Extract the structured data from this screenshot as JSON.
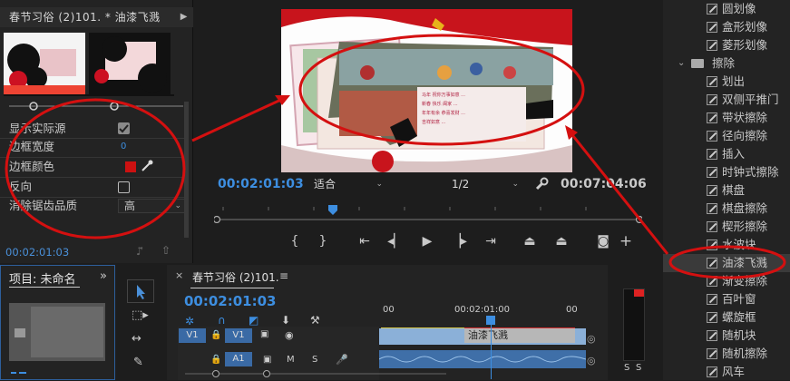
{
  "effect_controls": {
    "header": "春节习俗 (2)101. * 油漆飞溅",
    "props": [
      {
        "label": "显示实际源",
        "value": ""
      },
      {
        "label": "边框宽度",
        "value": "0"
      },
      {
        "label": "边框颜色",
        "value": ""
      },
      {
        "label": "反向",
        "value": ""
      },
      {
        "label": "消除锯齿品质",
        "value": "高"
      }
    ],
    "timecode": "00:02:01:03",
    "border_color": "#cc1111"
  },
  "program": {
    "current_time": "00:02:01:03",
    "fit": "适合",
    "resolution": "1/2",
    "duration": "00:07:04:06"
  },
  "effects_list": {
    "items": [
      "圆划像",
      "盒形划像",
      "菱形划像",
      "擦除",
      "划出",
      "双侧平推门",
      "带状擦除",
      "径向擦除",
      "插入",
      "时钟式擦除",
      "棋盘",
      "棋盘擦除",
      "楔形擦除",
      "水波块",
      "油漆飞溅",
      "渐变擦除",
      "百叶窗",
      "螺旋框",
      "随机块",
      "随机擦除",
      "风车"
    ],
    "selected": "油漆飞溅"
  },
  "project": {
    "title": "项目: 未命名"
  },
  "timeline": {
    "tab": "春节习俗 (2)101.",
    "timecode": "00:02:01:03",
    "ruler": [
      "00",
      "00:02:01:00",
      "00"
    ],
    "v1": "V1",
    "a1": "A1",
    "transition_label": "油漆飞溅"
  },
  "meter": {
    "labels": [
      "S",
      "S"
    ]
  }
}
